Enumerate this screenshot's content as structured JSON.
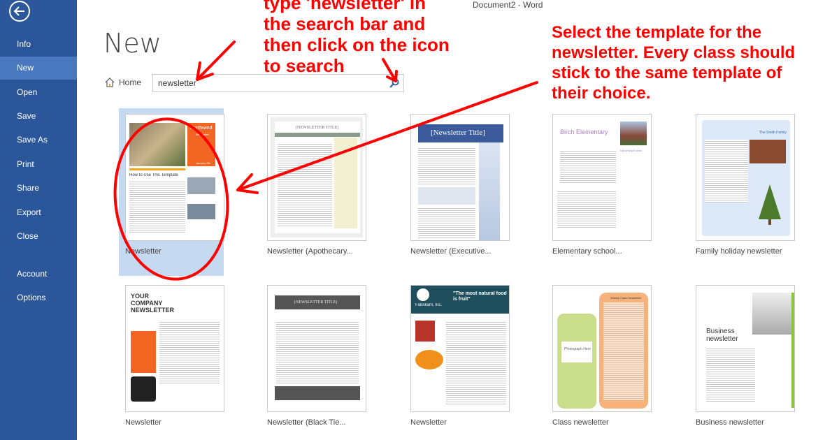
{
  "window_title": "Document2 - Word",
  "sidebar": {
    "items": [
      {
        "label": "Info"
      },
      {
        "label": "New",
        "active": true
      },
      {
        "label": "Open"
      },
      {
        "label": "Save"
      },
      {
        "label": "Save As"
      },
      {
        "label": "Print"
      },
      {
        "label": "Share"
      },
      {
        "label": "Export"
      },
      {
        "label": "Close"
      },
      {
        "label": "Account"
      },
      {
        "label": "Options"
      }
    ],
    "back_icon": "back-arrow-icon",
    "color": "#2b579a"
  },
  "page_title": "New",
  "home_label": "Home",
  "search": {
    "value": "newsletter",
    "icon": "search-icon"
  },
  "templates": [
    {
      "label": "Newsletter",
      "selected": true,
      "t1": "Northwind",
      "t2": "Newsletter",
      "t3": "How to Use This Template",
      "t4": "January 6th"
    },
    {
      "label": "Newsletter (Apothecary...",
      "t1": "[NEWSLETTER TITLE]"
    },
    {
      "label": "Newsletter (Executive...",
      "t1": "[Newsletter Title]"
    },
    {
      "label": "Elementary school...",
      "t1": "Birch Elementary",
      "t2": "Upcoming Events"
    },
    {
      "label": "Family holiday newsletter",
      "t1": "The Smith Family"
    },
    {
      "label": "Newsletter",
      "t1": "YOUR COMPANY NEWSLETTER"
    },
    {
      "label": "Newsletter (Black Tie...",
      "t1": "[NEWSLETTER TITLE]"
    },
    {
      "label": "Newsletter",
      "t1": "Fabrikam, Inc.",
      "t2": "\"The most natural food is fruit\""
    },
    {
      "label": "Class newsletter",
      "t1": "Weekly Class Newsletter",
      "t2": "Photograph Here"
    },
    {
      "label": "Business newsletter",
      "t1": "Business newsletter"
    }
  ],
  "annotations": {
    "left": [
      "type 'newsletter' in",
      "the search bar and",
      "then click on the icon",
      "to search"
    ],
    "right": [
      "Select the template for the",
      "newsletter. Every class should",
      "stick to the same template of",
      "their choice."
    ],
    "color": "#ff0000"
  }
}
